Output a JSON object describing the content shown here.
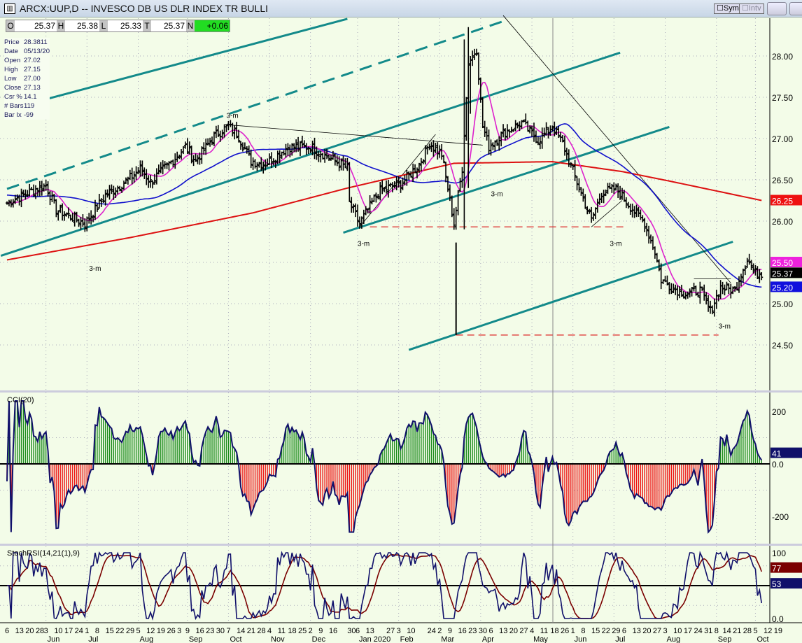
{
  "window": {
    "title": "ARCX:UUP,D -- INVESCO DB US DLR INDEX TR BULLI",
    "sym_label": "Sym",
    "intv_label": "Intv"
  },
  "ohlc_bar": {
    "o_label": "O",
    "o": "25.37",
    "h_label": "H",
    "h": "25.38",
    "l_label": "L",
    "l": "25.33",
    "t_label": "T",
    "t": "25.37",
    "n_label": "N",
    "n": "+0.06"
  },
  "info": [
    [
      "Price",
      "28.3811"
    ],
    [
      "Date",
      "05/13/20"
    ],
    [
      "Open",
      "27.02"
    ],
    [
      "High",
      "27.15"
    ],
    [
      "Low",
      "27.00"
    ],
    [
      "Close",
      "27.13"
    ],
    [
      "Csr %",
      "14.1"
    ],
    [
      "# Bars",
      "119"
    ],
    [
      "Bar Ix",
      "-99"
    ]
  ],
  "chart_data": [
    {
      "type": "ohlc",
      "title": "ARCX:UUP,D",
      "ylim": [
        24.3,
        28.4
      ],
      "price_ticks": [
        "28.00",
        "27.50",
        "27.00",
        "26.50",
        "26.00",
        "25.50",
        "25.00",
        "24.50"
      ],
      "price_tick_values": [
        28,
        27.5,
        27,
        26.5,
        26,
        25.5,
        25,
        24.5
      ],
      "close_keypoints": [
        [
          0,
          26.22
        ],
        [
          14,
          26.39
        ],
        [
          19,
          26.43
        ],
        [
          24,
          26.14
        ],
        [
          38,
          25.97
        ],
        [
          48,
          26.31
        ],
        [
          60,
          26.52
        ],
        [
          65,
          26.64
        ],
        [
          70,
          26.47
        ],
        [
          79,
          26.69
        ],
        [
          87,
          26.9
        ],
        [
          92,
          26.73
        ],
        [
          101,
          27.03
        ],
        [
          108,
          27.15
        ],
        [
          113,
          27.03
        ],
        [
          119,
          26.73
        ],
        [
          126,
          26.69
        ],
        [
          137,
          26.9
        ],
        [
          148,
          26.9
        ],
        [
          157,
          26.77
        ],
        [
          166,
          26.64
        ],
        [
          167,
          26.22
        ],
        [
          172,
          25.97
        ],
        [
          181,
          26.35
        ],
        [
          193,
          26.47
        ],
        [
          201,
          26.69
        ],
        [
          206,
          26.94
        ],
        [
          212,
          26.81
        ],
        [
          218,
          25.97
        ],
        [
          222,
          26.64
        ],
        [
          225,
          27.92
        ],
        [
          229,
          28.08
        ],
        [
          232,
          27.15
        ],
        [
          235,
          26.9
        ],
        [
          242,
          27.07
        ],
        [
          251,
          27.19
        ],
        [
          259,
          26.98
        ],
        [
          266,
          27.15
        ],
        [
          271,
          26.94
        ],
        [
          278,
          26.47
        ],
        [
          285,
          26.01
        ],
        [
          290,
          26.35
        ],
        [
          297,
          26.39
        ],
        [
          304,
          26.18
        ],
        [
          311,
          25.97
        ],
        [
          316,
          25.63
        ],
        [
          319,
          25.29
        ],
        [
          324,
          25.2
        ],
        [
          331,
          25.12
        ],
        [
          338,
          25.16
        ],
        [
          343,
          24.91
        ],
        [
          348,
          25.2
        ],
        [
          355,
          25.16
        ],
        [
          358,
          25.37
        ],
        [
          361,
          25.54
        ],
        [
          365,
          25.37
        ],
        [
          368,
          25.37
        ]
      ],
      "ma200_keypoints": [
        [
          0,
          25.53
        ],
        [
          60,
          25.8
        ],
        [
          120,
          26.1
        ],
        [
          166,
          26.4
        ],
        [
          218,
          26.7
        ],
        [
          266,
          26.72
        ],
        [
          300,
          26.6
        ],
        [
          324,
          26.48
        ],
        [
          368,
          26.25
        ]
      ],
      "series": [
        {
          "name": "Price",
          "color": "#000000"
        },
        {
          "name": "MA10",
          "color": "#dd22cc"
        },
        {
          "name": "MA50",
          "color": "#1010cc"
        },
        {
          "name": "MA200",
          "color": "#dd1111"
        }
      ],
      "right_labels": [
        {
          "text": "26.25",
          "value": 26.25,
          "color": "#ee1111"
        },
        {
          "text": "25.50",
          "value": 25.5,
          "color": "#ee22dd"
        },
        {
          "text": "25.37",
          "value": 25.37,
          "color": "#000000"
        },
        {
          "text": "25.20",
          "value": 25.2,
          "color": "#1010dd"
        }
      ],
      "trendlines": [
        {
          "style": "teal",
          "from": [
            0,
            27.35
          ],
          "to": [
            166,
            28.45
          ]
        },
        {
          "style": "teal-dash",
          "from": [
            0,
            26.39
          ],
          "to": [
            242,
            28.42
          ]
        },
        {
          "style": "teal",
          "from": [
            -3,
            25.58
          ],
          "to": [
            299,
            28.04
          ]
        },
        {
          "style": "teal",
          "from": [
            164,
            25.86
          ],
          "to": [
            323,
            27.14
          ]
        },
        {
          "style": "teal",
          "from": [
            196,
            24.44
          ],
          "to": [
            354,
            25.75
          ]
        },
        {
          "style": "thin",
          "from": [
            106,
            27.17
          ],
          "to": [
            232,
            26.92
          ]
        },
        {
          "style": "thin",
          "from": [
            242,
            28.49
          ],
          "to": [
            353,
            25.25
          ]
        },
        {
          "style": "thin",
          "from": [
            172,
            25.93
          ],
          "to": [
            209,
            27.05
          ]
        },
        {
          "style": "thin",
          "from": [
            285,
            25.93
          ],
          "to": [
            300,
            26.25
          ]
        },
        {
          "style": "thin",
          "from": [
            335,
            25.3
          ],
          "to": [
            353,
            25.3
          ]
        },
        {
          "style": "red-dash",
          "from": [
            177,
            25.93
          ],
          "to": [
            302,
            25.93
          ]
        },
        {
          "style": "red-dash",
          "from": [
            219,
            24.62
          ],
          "to": [
            347,
            24.62
          ]
        },
        {
          "style": "vbar",
          "from": [
            219,
            25.74
          ],
          "to": [
            219,
            24.62
          ]
        }
      ],
      "annotations": [
        {
          "text": "3-m",
          "at": [
            107,
            27.25
          ]
        },
        {
          "text": "3-m",
          "at": [
            40,
            25.4
          ]
        },
        {
          "text": "3-m",
          "at": [
            171,
            25.7
          ]
        },
        {
          "text": "3-m",
          "at": [
            236,
            26.3
          ]
        },
        {
          "text": "3-m",
          "at": [
            294,
            25.7
          ]
        },
        {
          "text": "3-m",
          "at": [
            347,
            24.7
          ]
        }
      ]
    },
    {
      "type": "line",
      "title": "CCI(20)",
      "ticks": [
        "200",
        "0.0",
        "-200"
      ],
      "tick_values": [
        200,
        0,
        -200
      ],
      "last_label": "41",
      "last_value": 41
    },
    {
      "type": "line",
      "title": "StochRSI(14,21(1),9)",
      "ticks": [
        "100",
        "0.0"
      ],
      "tick_values": [
        100,
        0
      ],
      "labels": [
        {
          "text": "77",
          "value": 77,
          "color": "#7a0000"
        },
        {
          "text": "53",
          "value": 53,
          "color": "#10106a"
        }
      ]
    }
  ],
  "x_axis": {
    "day_labels": [
      "6",
      "13",
      "20",
      "28",
      "3",
      "10",
      "17",
      "24",
      "1",
      "8",
      "15",
      "22",
      "29",
      "5",
      "12",
      "19",
      "26",
      "3",
      "9",
      "16",
      "23",
      "30",
      "7",
      "14",
      "21",
      "28",
      "4",
      "11",
      "18",
      "25",
      "2",
      "9",
      "16",
      "30",
      "6",
      "13",
      "27",
      "3",
      "10",
      "24",
      "2",
      "9",
      "16",
      "23",
      "30",
      "6",
      "13",
      "20",
      "27",
      "4",
      "11",
      "18",
      "26",
      "1",
      "8",
      "15",
      "22",
      "29",
      "6",
      "13",
      "20",
      "27",
      "3",
      "10",
      "17",
      "24",
      "31",
      "8",
      "14",
      "21",
      "28",
      "5",
      "12",
      "19"
    ],
    "day_indices": [
      0,
      5,
      10,
      15,
      19,
      24,
      29,
      34,
      39,
      44,
      49,
      54,
      59,
      64,
      69,
      74,
      79,
      84,
      88,
      93,
      98,
      103,
      108,
      113,
      118,
      123,
      128,
      133,
      138,
      143,
      148,
      153,
      158,
      167,
      171,
      176,
      186,
      191,
      196,
      206,
      211,
      216,
      221,
      226,
      231,
      236,
      241,
      246,
      251,
      256,
      261,
      266,
      271,
      276,
      281,
      286,
      291,
      296,
      301,
      306,
      311,
      316,
      321,
      326,
      331,
      336,
      341,
      346,
      350,
      355,
      360,
      365,
      370,
      375
    ],
    "months": [
      [
        "Jun",
        19
      ],
      [
        "Jul",
        39
      ],
      [
        "Aug",
        64
      ],
      [
        "Sep",
        88
      ],
      [
        "Oct",
        108
      ],
      [
        "Nov",
        128
      ],
      [
        "Dec",
        148
      ],
      [
        "Jan 2020",
        171
      ],
      [
        "Feb",
        191
      ],
      [
        "Mar",
        211
      ],
      [
        "Apr",
        231
      ],
      [
        "May",
        256
      ],
      [
        "Jun",
        276
      ],
      [
        "Jul",
        296
      ],
      [
        "Aug",
        321
      ],
      [
        "Sep",
        346
      ],
      [
        "Oct",
        365
      ]
    ]
  }
}
